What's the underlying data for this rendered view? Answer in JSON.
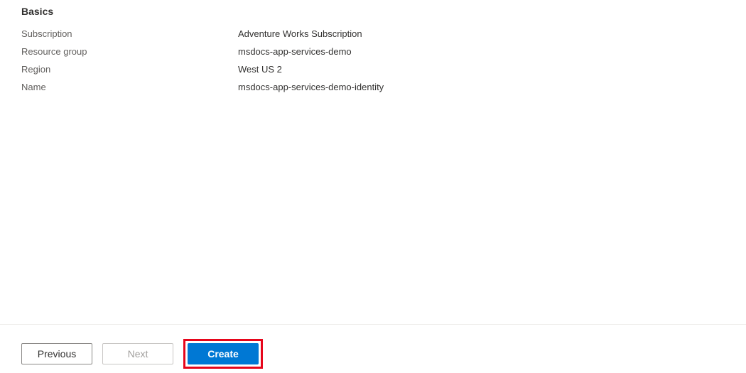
{
  "section": {
    "heading": "Basics",
    "rows": [
      {
        "label": "Subscription",
        "value": "Adventure Works Subscription"
      },
      {
        "label": "Resource group",
        "value": "msdocs-app-services-demo"
      },
      {
        "label": "Region",
        "value": "West US 2"
      },
      {
        "label": "Name",
        "value": "msdocs-app-services-demo-identity"
      }
    ]
  },
  "footer": {
    "previous": "Previous",
    "next": "Next",
    "create": "Create"
  }
}
